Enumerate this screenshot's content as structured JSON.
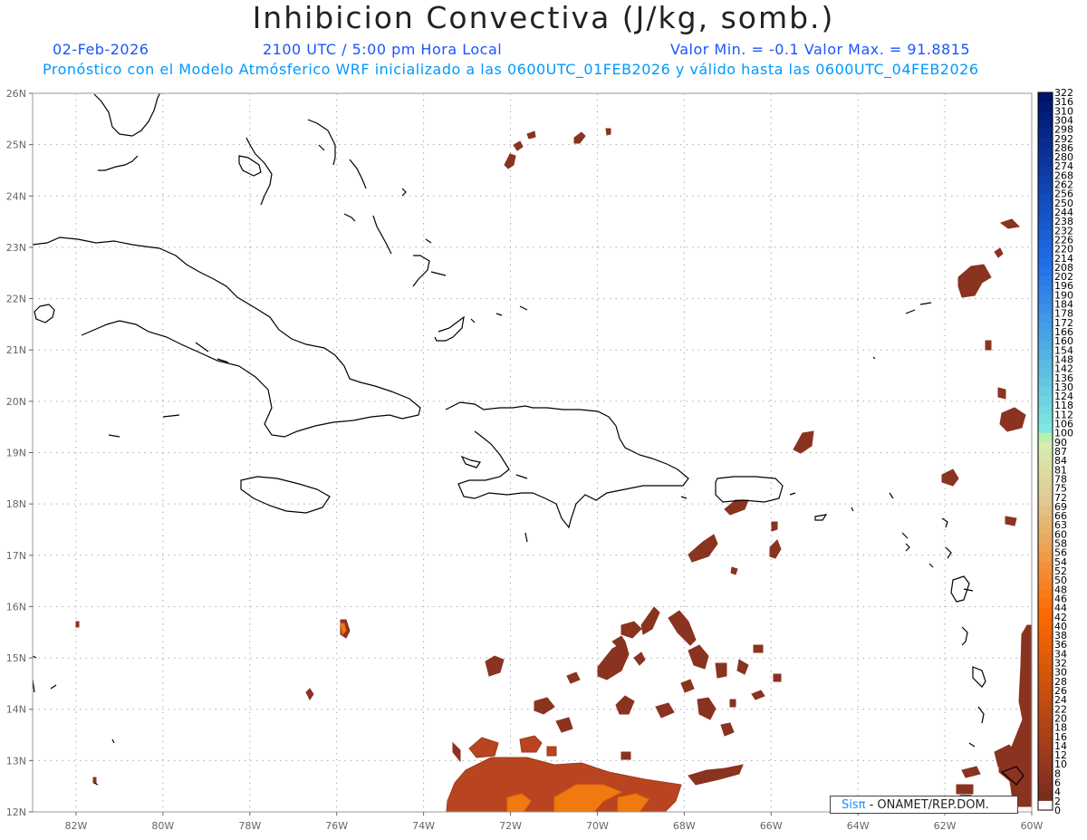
{
  "header": {
    "title": "Inhibicion Convectiva (J/kg, somb.)",
    "date": "02-Feb-2026",
    "time": "2100 UTC / 5:00 pm Hora Local",
    "minmax": "Valor Min. = -0.1  Valor Max. = 91.8815",
    "model_line": "Pronóstico con el Modelo Atmósferico WRF inicializado a las 0600UTC_01FEB2026 y válido hasta las  0600UTC_04FEB2026"
  },
  "map": {
    "lon_min": -83,
    "lon_max": -60,
    "lat_min": 12,
    "lat_max": 26,
    "lat_labels": [
      "26N",
      "25N",
      "24N",
      "23N",
      "22N",
      "21N",
      "20N",
      "19N",
      "18N",
      "17N",
      "16N",
      "15N",
      "14N",
      "13N",
      "12N"
    ],
    "lon_labels": [
      "82W",
      "80W",
      "78W",
      "76W",
      "74W",
      "72W",
      "70W",
      "68W",
      "66W",
      "64W",
      "62W",
      "60W"
    ],
    "coast_color": "#000000",
    "grid_color": "#aaaaaa",
    "field_colors": {
      "low": "#8a3320",
      "mid": "#b8451f",
      "high": "#f07a10"
    }
  },
  "colorbar": {
    "labels": [
      "322",
      "316",
      "310",
      "304",
      "298",
      "292",
      "286",
      "280",
      "274",
      "268",
      "262",
      "256",
      "250",
      "244",
      "238",
      "232",
      "226",
      "220",
      "214",
      "208",
      "202",
      "196",
      "190",
      "184",
      "178",
      "172",
      "166",
      "160",
      "154",
      "148",
      "142",
      "136",
      "130",
      "124",
      "118",
      "112",
      "106",
      "100",
      "90",
      "87",
      "84",
      "81",
      "78",
      "75",
      "72",
      "69",
      "66",
      "63",
      "60",
      "58",
      "56",
      "54",
      "52",
      "50",
      "48",
      "46",
      "44",
      "42",
      "40",
      "38",
      "36",
      "34",
      "32",
      "30",
      "28",
      "26",
      "24",
      "22",
      "20",
      "18",
      "16",
      "14",
      "12",
      "10",
      "8",
      "6",
      "4",
      "2",
      "0"
    ]
  },
  "credit": {
    "brand": "Sisπ",
    "text": "- ONAMET/REP.DOM."
  }
}
